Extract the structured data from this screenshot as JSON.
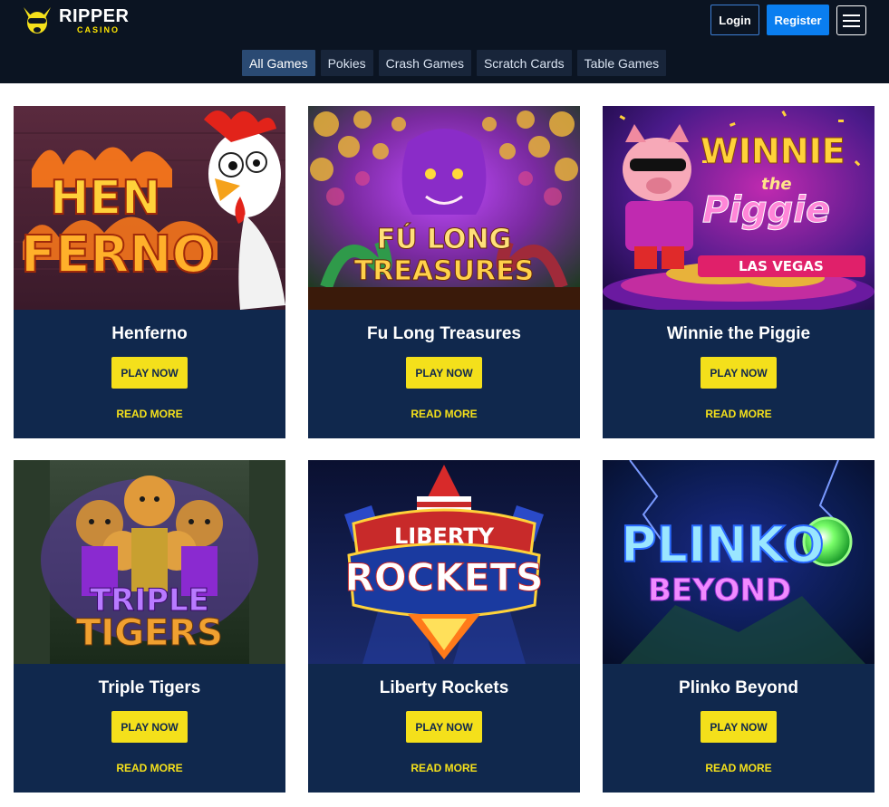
{
  "header": {
    "logo": {
      "brand": "RIPPER",
      "sub": "CASINO"
    },
    "login_label": "Login",
    "register_label": "Register"
  },
  "tabs": [
    {
      "label": "All Games",
      "active": true
    },
    {
      "label": "Pokies",
      "active": false
    },
    {
      "label": "Crash Games",
      "active": false
    },
    {
      "label": "Scratch Cards",
      "active": false
    },
    {
      "label": "Table Games",
      "active": false
    }
  ],
  "games": [
    {
      "title": "Henferno",
      "art_text": [
        "HEN",
        "FERNO"
      ],
      "play_label": "PLAY NOW",
      "read_label": "READ MORE"
    },
    {
      "title": "Fu Long Treasures",
      "art_text": [
        "FÚ LONG",
        "TREASURES"
      ],
      "play_label": "PLAY NOW",
      "read_label": "READ MORE"
    },
    {
      "title": "Winnie the Piggie",
      "art_text": [
        "WINNIE",
        "the",
        "Piggie",
        "LAS VEGAS"
      ],
      "play_label": "PLAY NOW",
      "read_label": "READ MORE"
    },
    {
      "title": "Triple Tigers",
      "art_text": [
        "TRIPLE",
        "TIGERS"
      ],
      "play_label": "PLAY NOW",
      "read_label": "READ MORE"
    },
    {
      "title": "Liberty Rockets",
      "art_text": [
        "LIBERTY",
        "ROCKETS"
      ],
      "play_label": "PLAY NOW",
      "read_label": "READ MORE"
    },
    {
      "title": "Plinko Beyond",
      "art_text": [
        "PLINKO",
        "BEYOND"
      ],
      "play_label": "PLAY NOW",
      "read_label": "READ MORE"
    }
  ],
  "colors": {
    "header_bg": "#0b1422",
    "card_bg": "#10284d",
    "accent_yellow": "#f4e01b",
    "register_blue": "#0a7ef0"
  }
}
